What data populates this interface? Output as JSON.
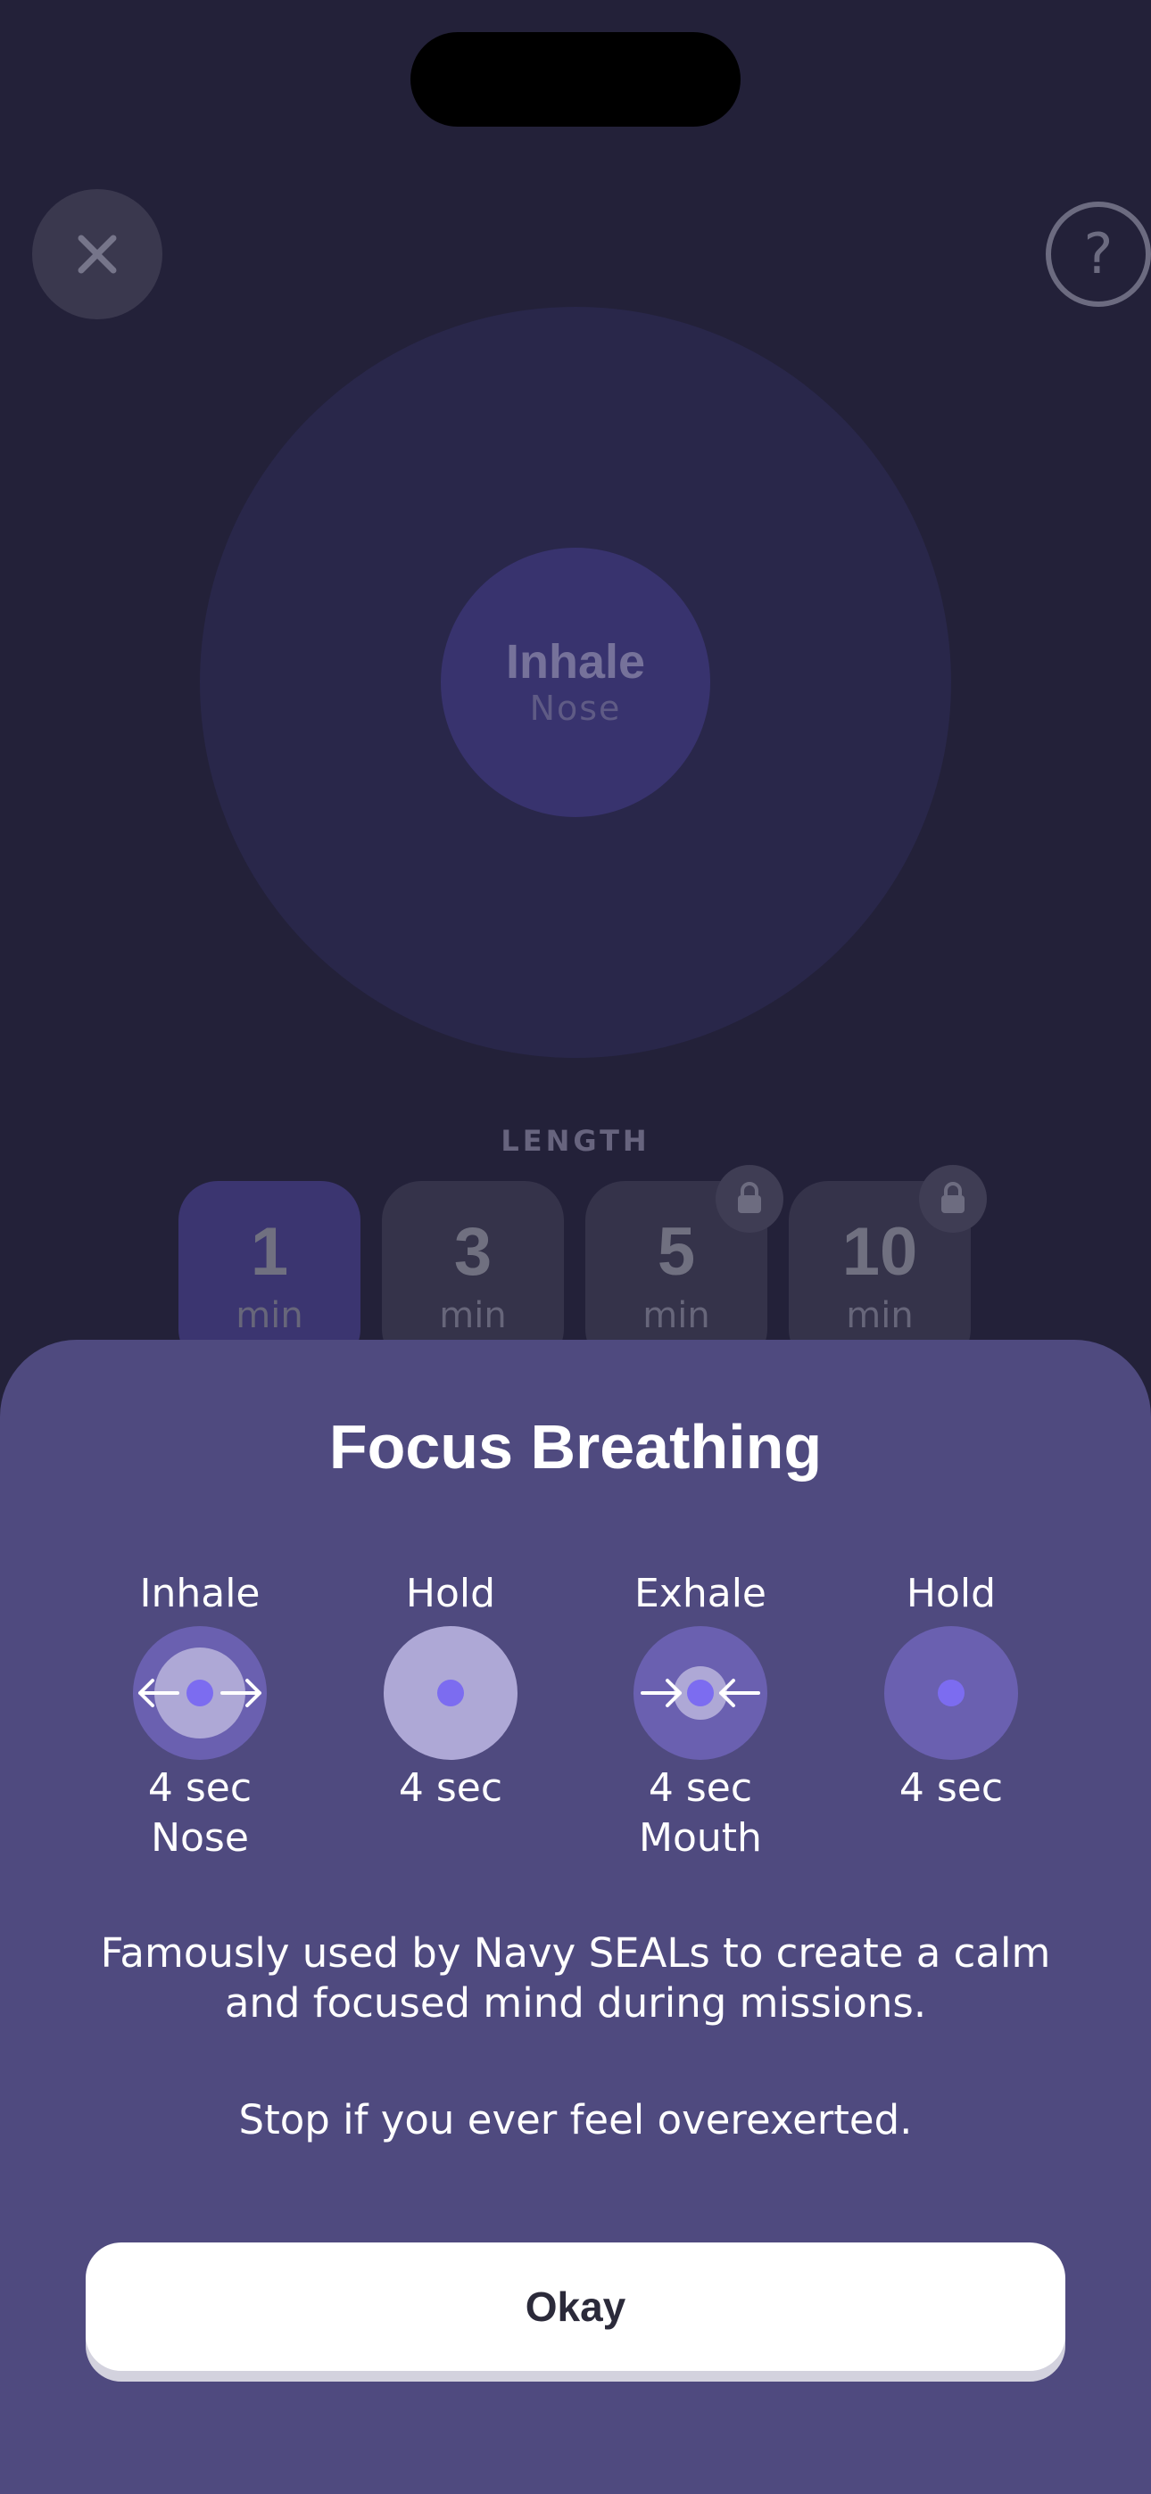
{
  "top": {
    "close_icon": "close-icon",
    "help_icon": "help-icon",
    "help_glyph": "?"
  },
  "breath_visual": {
    "phase": "Inhale",
    "method": "Nose"
  },
  "length": {
    "label": "LENGTH",
    "options": [
      {
        "value": "1",
        "unit": "min",
        "selected": true,
        "locked": false
      },
      {
        "value": "3",
        "unit": "min",
        "selected": false,
        "locked": false
      },
      {
        "value": "5",
        "unit": "min",
        "selected": false,
        "locked": true
      },
      {
        "value": "10",
        "unit": "min",
        "selected": false,
        "locked": true
      }
    ]
  },
  "sheet": {
    "title": "Focus Breathing",
    "steps": [
      {
        "label": "Inhale",
        "duration": "4 sec",
        "method": "Nose",
        "icon": "inhale-arrows-icon"
      },
      {
        "label": "Hold",
        "duration": "4 sec",
        "method": "",
        "icon": "hold-full-icon"
      },
      {
        "label": "Exhale",
        "duration": "4 sec",
        "method": "Mouth",
        "icon": "exhale-arrows-icon"
      },
      {
        "label": "Hold",
        "duration": "4 sec",
        "method": "",
        "icon": "hold-empty-icon"
      }
    ],
    "description": "Famously used by Navy SEALs to create a calm and focused mind during missions.",
    "warning": "Stop if you ever feel overexerted.",
    "okay_label": "Okay"
  },
  "colors": {
    "background": "#232139",
    "sheet": "#4f4a7f",
    "accent_dot": "#7c6cf0",
    "button": "#ffffff"
  }
}
